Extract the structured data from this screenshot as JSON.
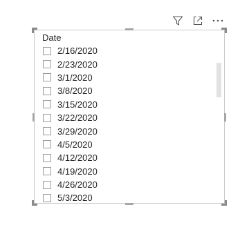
{
  "visual_header": {
    "icons": [
      "filter-icon",
      "focus-mode-icon",
      "more-options-icon"
    ]
  },
  "slicer": {
    "title": "Date",
    "items": [
      {
        "label": "2/16/2020",
        "checked": false
      },
      {
        "label": "2/23/2020",
        "checked": false
      },
      {
        "label": "3/1/2020",
        "checked": false
      },
      {
        "label": "3/8/2020",
        "checked": false
      },
      {
        "label": "3/15/2020",
        "checked": false
      },
      {
        "label": "3/22/2020",
        "checked": false
      },
      {
        "label": "3/29/2020",
        "checked": false
      },
      {
        "label": "4/5/2020",
        "checked": false
      },
      {
        "label": "4/12/2020",
        "checked": false
      },
      {
        "label": "4/19/2020",
        "checked": false
      },
      {
        "label": "4/26/2020",
        "checked": false
      },
      {
        "label": "5/3/2020",
        "checked": false
      }
    ]
  },
  "colors": {
    "text": "#252423",
    "border": "#c8c8c8",
    "checkbox_border": "#9b9b9b",
    "scrollbar_thumb": "#e2e2e2"
  }
}
